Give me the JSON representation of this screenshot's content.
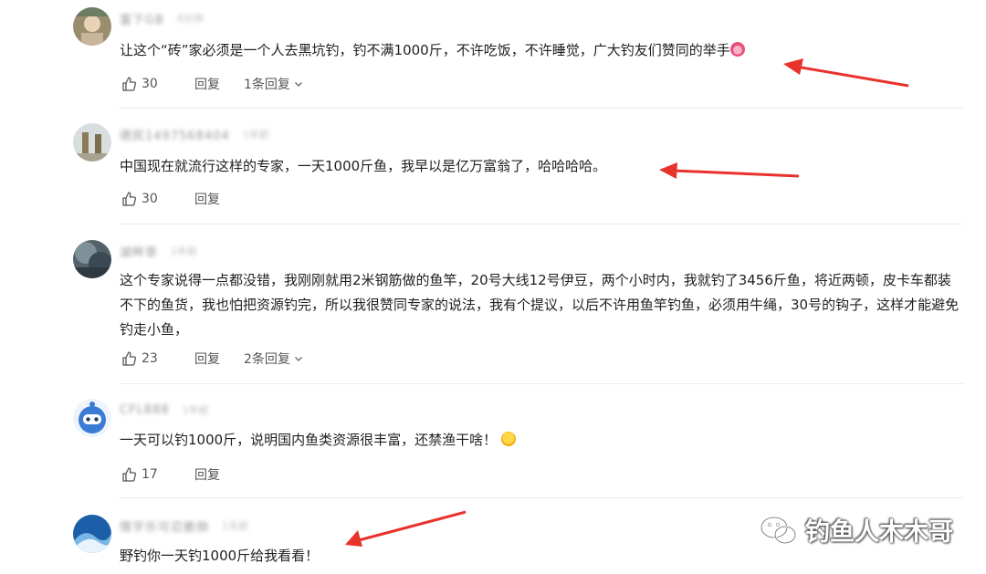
{
  "comments": [
    {
      "username": "富下GB",
      "time": "8分钟",
      "text_before": "让这个“砖”家必须是一个人去黑坑钓，钓不满1000斤，不许吃饭，不许睡觉，广大钓友们赞同的举手",
      "likes": "30",
      "reply_label": "回复",
      "replies_label": "1条回复"
    },
    {
      "username": "德民1497568404",
      "time": "1年前",
      "text": "中国现在就流行这样的专家，一天1000斤鱼，我早以是亿万富翁了，哈哈哈哈。",
      "likes": "30",
      "reply_label": "回复"
    },
    {
      "username": "湖畔草",
      "time": "1年前",
      "text": "这个专家说得一点都没错，我刚刚就用2米钢筋做的鱼竿，20号大线12号伊豆，两个小时内，我就钓了3456斤鱼，将近两顿，皮卡车都装不下的鱼货，我也怕把资源钓完，所以我很赞同专家的说法，我有个提议，以后不许用鱼竿钓鱼，必须用牛绳，30号的钩子，这样才能避免钓走小鱼，",
      "likes": "23",
      "reply_label": "回复",
      "replies_label": "2条回复"
    },
    {
      "username": "CFL888",
      "time": "1年前",
      "text_before": "一天可以钓1000斤，说明国内鱼类资源很丰富，还禁渔干啥！",
      "likes": "17",
      "reply_label": "回复"
    },
    {
      "username": "情字乐可忍脆倒",
      "time": "1天前",
      "text": "野钓你一天钓1000斤给我看看！"
    }
  ],
  "watermark": {
    "text": "钓鱼人木木哥"
  },
  "colors": {
    "arrow": "#e8322b",
    "text": "#1f1f1f",
    "muted": "#555555"
  },
  "icons": [
    "thumbs-up-icon",
    "chevron-down-icon",
    "wechat-icon"
  ]
}
